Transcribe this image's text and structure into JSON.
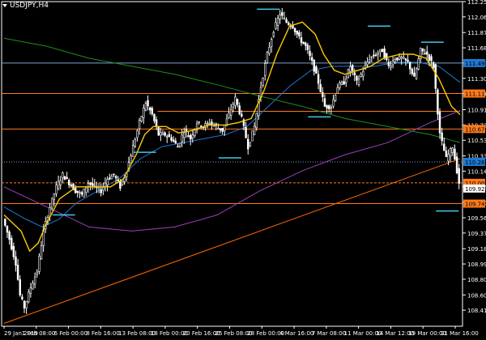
{
  "window": {
    "symbol_label": "USDJPY,H4"
  },
  "colors": {
    "background": "#000000",
    "candle": "#ffffff",
    "grid_axis": "#ffffff",
    "ma_fast": "#ffcc00",
    "ma_slow": "#1f78d1",
    "ma_green": "#1e8f1e",
    "ma_purple": "#a040c0",
    "trendline": "#ff6a00",
    "level_line": "#ff7a1a",
    "level_box": "#ff7a1a",
    "level_box_current": "#ffffff",
    "blue_box": "#1f78d1",
    "cyan_marker": "#40c8e8"
  },
  "chart_data": {
    "type": "candlestick",
    "title": "USDJPY,H4",
    "ylim": [
      108.215,
      112.255
    ],
    "y_ticks": [
      "112.255",
      "112.065",
      "111.870",
      "111.680",
      "111.490",
      "111.300",
      "111.111",
      "110.910",
      "110.720",
      "110.530",
      "110.335",
      "110.145",
      "109.950",
      "109.755",
      "109.565",
      "109.375",
      "109.180",
      "108.990",
      "108.800",
      "108.605",
      "108.415"
    ],
    "x_ticks": [
      "29 Jan 2019",
      "1 Feb 08:00",
      "6 Feb 00:00",
      "8 Feb 16:00",
      "13 Feb 08:00",
      "18 Feb 00:00",
      "20 Feb 16:00",
      "25 Feb 08:00",
      "28 Feb 00:00",
      "4 Mar 16:00",
      "7 Mar 08:00",
      "11 Mar 00:00",
      "14 Mar 12:00",
      "19 Mar 00:00",
      "21 Mar 16:00"
    ],
    "close_path": [
      [
        0,
        109.55
      ],
      [
        3,
        109.3
      ],
      [
        6,
        109.0
      ],
      [
        8,
        108.6
      ],
      [
        10,
        108.45
      ],
      [
        13,
        108.7
      ],
      [
        16,
        108.9
      ],
      [
        19,
        109.4
      ],
      [
        22,
        109.7
      ],
      [
        25,
        109.95
      ],
      [
        28,
        110.1
      ],
      [
        31,
        110.0
      ],
      [
        34,
        109.9
      ],
      [
        37,
        109.85
      ],
      [
        40,
        110.0
      ],
      [
        43,
        109.95
      ],
      [
        46,
        109.9
      ],
      [
        49,
        110.05
      ],
      [
        52,
        110.1
      ],
      [
        55,
        109.95
      ],
      [
        58,
        110.15
      ],
      [
        61,
        110.45
      ],
      [
        64,
        110.75
      ],
      [
        67,
        111.0
      ],
      [
        70,
        110.85
      ],
      [
        73,
        110.6
      ],
      [
        76,
        110.6
      ],
      [
        79,
        110.55
      ],
      [
        82,
        110.45
      ],
      [
        85,
        110.65
      ],
      [
        88,
        110.55
      ],
      [
        91,
        110.75
      ],
      [
        94,
        110.7
      ],
      [
        97,
        110.75
      ],
      [
        100,
        110.7
      ],
      [
        103,
        110.65
      ],
      [
        106,
        110.85
      ],
      [
        109,
        111.05
      ],
      [
        112,
        110.8
      ],
      [
        115,
        110.45
      ],
      [
        118,
        110.7
      ],
      [
        121,
        111.2
      ],
      [
        124,
        111.6
      ],
      [
        127,
        111.9
      ],
      [
        130,
        112.1
      ],
      [
        133,
        112.0
      ],
      [
        136,
        111.95
      ],
      [
        139,
        111.8
      ],
      [
        142,
        111.7
      ],
      [
        145,
        111.5
      ],
      [
        148,
        111.25
      ],
      [
        151,
        110.95
      ],
      [
        154,
        110.95
      ],
      [
        157,
        111.2
      ],
      [
        160,
        111.25
      ],
      [
        163,
        111.45
      ],
      [
        166,
        111.25
      ],
      [
        169,
        111.4
      ],
      [
        172,
        111.55
      ],
      [
        175,
        111.6
      ],
      [
        178,
        111.65
      ],
      [
        181,
        111.45
      ],
      [
        184,
        111.55
      ],
      [
        187,
        111.55
      ],
      [
        190,
        111.5
      ],
      [
        193,
        111.3
      ],
      [
        196,
        111.65
      ],
      [
        199,
        111.6
      ],
      [
        202,
        111.45
      ],
      [
        205,
        110.6
      ],
      [
        208,
        110.3
      ],
      [
        211,
        110.45
      ],
      [
        214,
        110.0
      ]
    ],
    "ma_fast": [
      [
        0,
        109.6
      ],
      [
        8,
        109.4
      ],
      [
        12,
        109.15
      ],
      [
        16,
        109.25
      ],
      [
        20,
        109.5
      ],
      [
        26,
        109.8
      ],
      [
        34,
        109.95
      ],
      [
        42,
        109.95
      ],
      [
        50,
        109.95
      ],
      [
        56,
        110.05
      ],
      [
        62,
        110.35
      ],
      [
        66,
        110.6
      ],
      [
        70,
        110.7
      ],
      [
        76,
        110.7
      ],
      [
        82,
        110.62
      ],
      [
        88,
        110.65
      ],
      [
        96,
        110.72
      ],
      [
        104,
        110.72
      ],
      [
        110,
        110.75
      ],
      [
        116,
        110.8
      ],
      [
        122,
        111.15
      ],
      [
        128,
        111.6
      ],
      [
        134,
        111.95
      ],
      [
        140,
        112.0
      ],
      [
        146,
        111.85
      ],
      [
        150,
        111.6
      ],
      [
        155,
        111.4
      ],
      [
        160,
        111.35
      ],
      [
        166,
        111.4
      ],
      [
        172,
        111.45
      ],
      [
        178,
        111.55
      ],
      [
        186,
        111.6
      ],
      [
        192,
        111.6
      ],
      [
        198,
        111.55
      ],
      [
        204,
        111.3
      ],
      [
        210,
        110.95
      ],
      [
        214,
        110.85
      ]
    ],
    "ma_slow": [
      [
        0,
        109.7
      ],
      [
        10,
        109.55
      ],
      [
        18,
        109.45
      ],
      [
        26,
        109.55
      ],
      [
        34,
        109.75
      ],
      [
        44,
        109.9
      ],
      [
        54,
        110.05
      ],
      [
        64,
        110.3
      ],
      [
        74,
        110.45
      ],
      [
        84,
        110.5
      ],
      [
        94,
        110.55
      ],
      [
        104,
        110.6
      ],
      [
        114,
        110.7
      ],
      [
        124,
        110.95
      ],
      [
        134,
        111.2
      ],
      [
        144,
        111.4
      ],
      [
        154,
        111.45
      ],
      [
        164,
        111.45
      ],
      [
        174,
        111.45
      ],
      [
        184,
        111.5
      ],
      [
        194,
        111.5
      ],
      [
        204,
        111.45
      ],
      [
        214,
        111.25
      ]
    ],
    "ma_green": [
      [
        0,
        111.8
      ],
      [
        20,
        111.7
      ],
      [
        40,
        111.55
      ],
      [
        60,
        111.45
      ],
      [
        80,
        111.35
      ],
      [
        100,
        111.22
      ],
      [
        120,
        111.08
      ],
      [
        140,
        110.95
      ],
      [
        160,
        110.8
      ],
      [
        180,
        110.7
      ],
      [
        200,
        110.6
      ],
      [
        214,
        110.5
      ]
    ],
    "ma_purple": [
      [
        0,
        109.95
      ],
      [
        20,
        109.7
      ],
      [
        40,
        109.45
      ],
      [
        60,
        109.4
      ],
      [
        80,
        109.45
      ],
      [
        100,
        109.6
      ],
      [
        120,
        109.9
      ],
      [
        140,
        110.15
      ],
      [
        160,
        110.35
      ],
      [
        180,
        110.5
      ],
      [
        200,
        110.75
      ],
      [
        214,
        110.9
      ]
    ],
    "trendline": [
      [
        0,
        108.25
      ],
      [
        214,
        110.3
      ]
    ],
    "levels": [
      {
        "value": 111.49,
        "label": "111.490",
        "style": "solid",
        "box": "blue"
      },
      {
        "value": 111.111,
        "label": "111.111",
        "style": "solid",
        "box": "orange"
      },
      {
        "value": 110.67,
        "label": "110.670",
        "style": "solid",
        "box": "orange"
      },
      {
        "value": 110.26,
        "label": "110.260",
        "style": "dotted",
        "box": "blue"
      },
      {
        "value": 110.0,
        "label": "110.000",
        "style": "dashed",
        "box": "orange"
      },
      {
        "value": 109.741,
        "label": "109.741",
        "style": "solid",
        "box": "orange"
      }
    ],
    "current_price": {
      "value": 109.929,
      "label": "109.929"
    },
    "resistance_segment": {
      "value": 110.89,
      "x_from": 72,
      "x_to": 214
    },
    "cyan_markers": [
      {
        "x": 124,
        "value": 112.16
      },
      {
        "x": 176,
        "value": 111.95
      },
      {
        "x": 201,
        "value": 111.75
      },
      {
        "x": 148,
        "value": 110.82
      },
      {
        "x": 66,
        "value": 110.38
      },
      {
        "x": 106,
        "value": 110.31
      },
      {
        "x": 28,
        "value": 109.6
      },
      {
        "x": 208,
        "value": 109.65
      }
    ]
  }
}
